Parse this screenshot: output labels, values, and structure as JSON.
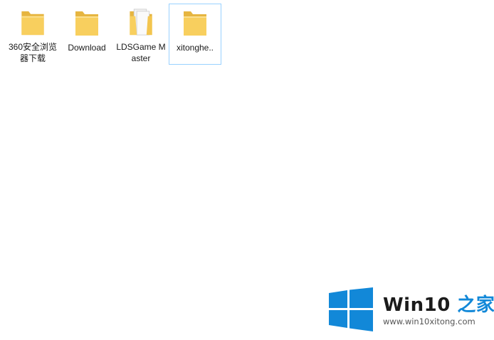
{
  "folders": [
    {
      "label": "360安全浏览器下载",
      "icon": "folder-icon",
      "selected": false
    },
    {
      "label": "Download",
      "icon": "folder-icon",
      "selected": false
    },
    {
      "label": "LDSGame Master",
      "icon": "folder-with-files-icon",
      "selected": false
    },
    {
      "label": "xitonghe..",
      "icon": "folder-icon",
      "selected": true
    }
  ],
  "watermark": {
    "brand": "Win10",
    "suffix": "之家",
    "url": "www.win10xitong.com"
  },
  "colors": {
    "folder_body": "#f8cf5e",
    "folder_back": "#e6b540",
    "selection_border": "#99d1ff",
    "logo_blue": "#1288d8"
  }
}
